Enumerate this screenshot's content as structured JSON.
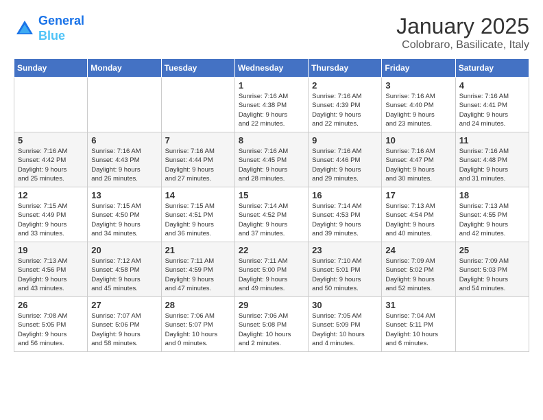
{
  "logo": {
    "line1": "General",
    "line2": "Blue"
  },
  "title": "January 2025",
  "subtitle": "Colobraro, Basilicate, Italy",
  "headers": [
    "Sunday",
    "Monday",
    "Tuesday",
    "Wednesday",
    "Thursday",
    "Friday",
    "Saturday"
  ],
  "weeks": [
    [
      {
        "day": "",
        "info": ""
      },
      {
        "day": "",
        "info": ""
      },
      {
        "day": "",
        "info": ""
      },
      {
        "day": "1",
        "info": "Sunrise: 7:16 AM\nSunset: 4:38 PM\nDaylight: 9 hours\nand 22 minutes."
      },
      {
        "day": "2",
        "info": "Sunrise: 7:16 AM\nSunset: 4:39 PM\nDaylight: 9 hours\nand 22 minutes."
      },
      {
        "day": "3",
        "info": "Sunrise: 7:16 AM\nSunset: 4:40 PM\nDaylight: 9 hours\nand 23 minutes."
      },
      {
        "day": "4",
        "info": "Sunrise: 7:16 AM\nSunset: 4:41 PM\nDaylight: 9 hours\nand 24 minutes."
      }
    ],
    [
      {
        "day": "5",
        "info": "Sunrise: 7:16 AM\nSunset: 4:42 PM\nDaylight: 9 hours\nand 25 minutes."
      },
      {
        "day": "6",
        "info": "Sunrise: 7:16 AM\nSunset: 4:43 PM\nDaylight: 9 hours\nand 26 minutes."
      },
      {
        "day": "7",
        "info": "Sunrise: 7:16 AM\nSunset: 4:44 PM\nDaylight: 9 hours\nand 27 minutes."
      },
      {
        "day": "8",
        "info": "Sunrise: 7:16 AM\nSunset: 4:45 PM\nDaylight: 9 hours\nand 28 minutes."
      },
      {
        "day": "9",
        "info": "Sunrise: 7:16 AM\nSunset: 4:46 PM\nDaylight: 9 hours\nand 29 minutes."
      },
      {
        "day": "10",
        "info": "Sunrise: 7:16 AM\nSunset: 4:47 PM\nDaylight: 9 hours\nand 30 minutes."
      },
      {
        "day": "11",
        "info": "Sunrise: 7:16 AM\nSunset: 4:48 PM\nDaylight: 9 hours\nand 31 minutes."
      }
    ],
    [
      {
        "day": "12",
        "info": "Sunrise: 7:15 AM\nSunset: 4:49 PM\nDaylight: 9 hours\nand 33 minutes."
      },
      {
        "day": "13",
        "info": "Sunrise: 7:15 AM\nSunset: 4:50 PM\nDaylight: 9 hours\nand 34 minutes."
      },
      {
        "day": "14",
        "info": "Sunrise: 7:15 AM\nSunset: 4:51 PM\nDaylight: 9 hours\nand 36 minutes."
      },
      {
        "day": "15",
        "info": "Sunrise: 7:14 AM\nSunset: 4:52 PM\nDaylight: 9 hours\nand 37 minutes."
      },
      {
        "day": "16",
        "info": "Sunrise: 7:14 AM\nSunset: 4:53 PM\nDaylight: 9 hours\nand 39 minutes."
      },
      {
        "day": "17",
        "info": "Sunrise: 7:13 AM\nSunset: 4:54 PM\nDaylight: 9 hours\nand 40 minutes."
      },
      {
        "day": "18",
        "info": "Sunrise: 7:13 AM\nSunset: 4:55 PM\nDaylight: 9 hours\nand 42 minutes."
      }
    ],
    [
      {
        "day": "19",
        "info": "Sunrise: 7:13 AM\nSunset: 4:56 PM\nDaylight: 9 hours\nand 43 minutes."
      },
      {
        "day": "20",
        "info": "Sunrise: 7:12 AM\nSunset: 4:58 PM\nDaylight: 9 hours\nand 45 minutes."
      },
      {
        "day": "21",
        "info": "Sunrise: 7:11 AM\nSunset: 4:59 PM\nDaylight: 9 hours\nand 47 minutes."
      },
      {
        "day": "22",
        "info": "Sunrise: 7:11 AM\nSunset: 5:00 PM\nDaylight: 9 hours\nand 49 minutes."
      },
      {
        "day": "23",
        "info": "Sunrise: 7:10 AM\nSunset: 5:01 PM\nDaylight: 9 hours\nand 50 minutes."
      },
      {
        "day": "24",
        "info": "Sunrise: 7:09 AM\nSunset: 5:02 PM\nDaylight: 9 hours\nand 52 minutes."
      },
      {
        "day": "25",
        "info": "Sunrise: 7:09 AM\nSunset: 5:03 PM\nDaylight: 9 hours\nand 54 minutes."
      }
    ],
    [
      {
        "day": "26",
        "info": "Sunrise: 7:08 AM\nSunset: 5:05 PM\nDaylight: 9 hours\nand 56 minutes."
      },
      {
        "day": "27",
        "info": "Sunrise: 7:07 AM\nSunset: 5:06 PM\nDaylight: 9 hours\nand 58 minutes."
      },
      {
        "day": "28",
        "info": "Sunrise: 7:06 AM\nSunset: 5:07 PM\nDaylight: 10 hours\nand 0 minutes."
      },
      {
        "day": "29",
        "info": "Sunrise: 7:06 AM\nSunset: 5:08 PM\nDaylight: 10 hours\nand 2 minutes."
      },
      {
        "day": "30",
        "info": "Sunrise: 7:05 AM\nSunset: 5:09 PM\nDaylight: 10 hours\nand 4 minutes."
      },
      {
        "day": "31",
        "info": "Sunrise: 7:04 AM\nSunset: 5:11 PM\nDaylight: 10 hours\nand 6 minutes."
      },
      {
        "day": "",
        "info": ""
      }
    ]
  ]
}
